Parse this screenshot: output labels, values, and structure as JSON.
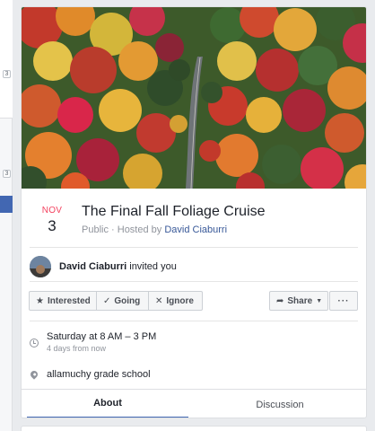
{
  "left_column": {
    "badges": [
      "3",
      "3"
    ]
  },
  "event": {
    "cover_icon": "autumn-forest-road-photo",
    "month": "NOV",
    "day": "3",
    "title": "The Final Fall Foliage Cruise",
    "visibility": "Public",
    "hosted_by_prefix": "· Hosted by",
    "host": "David Ciaburri",
    "inviter": {
      "name": "David Ciaburri",
      "text": "invited you"
    },
    "actions": {
      "interested": "Interested",
      "going": "Going",
      "ignore": "Ignore",
      "share": "Share",
      "more": "···"
    },
    "time": {
      "main": "Saturday at 8 AM – 3 PM",
      "sub": "4 days from now"
    },
    "location": "allamuchy grade school",
    "tabs": {
      "about": "About",
      "discussion": "Discussion"
    }
  },
  "colors": {
    "accent": "#4267b2",
    "month": "#f3425f",
    "link": "#385898"
  }
}
